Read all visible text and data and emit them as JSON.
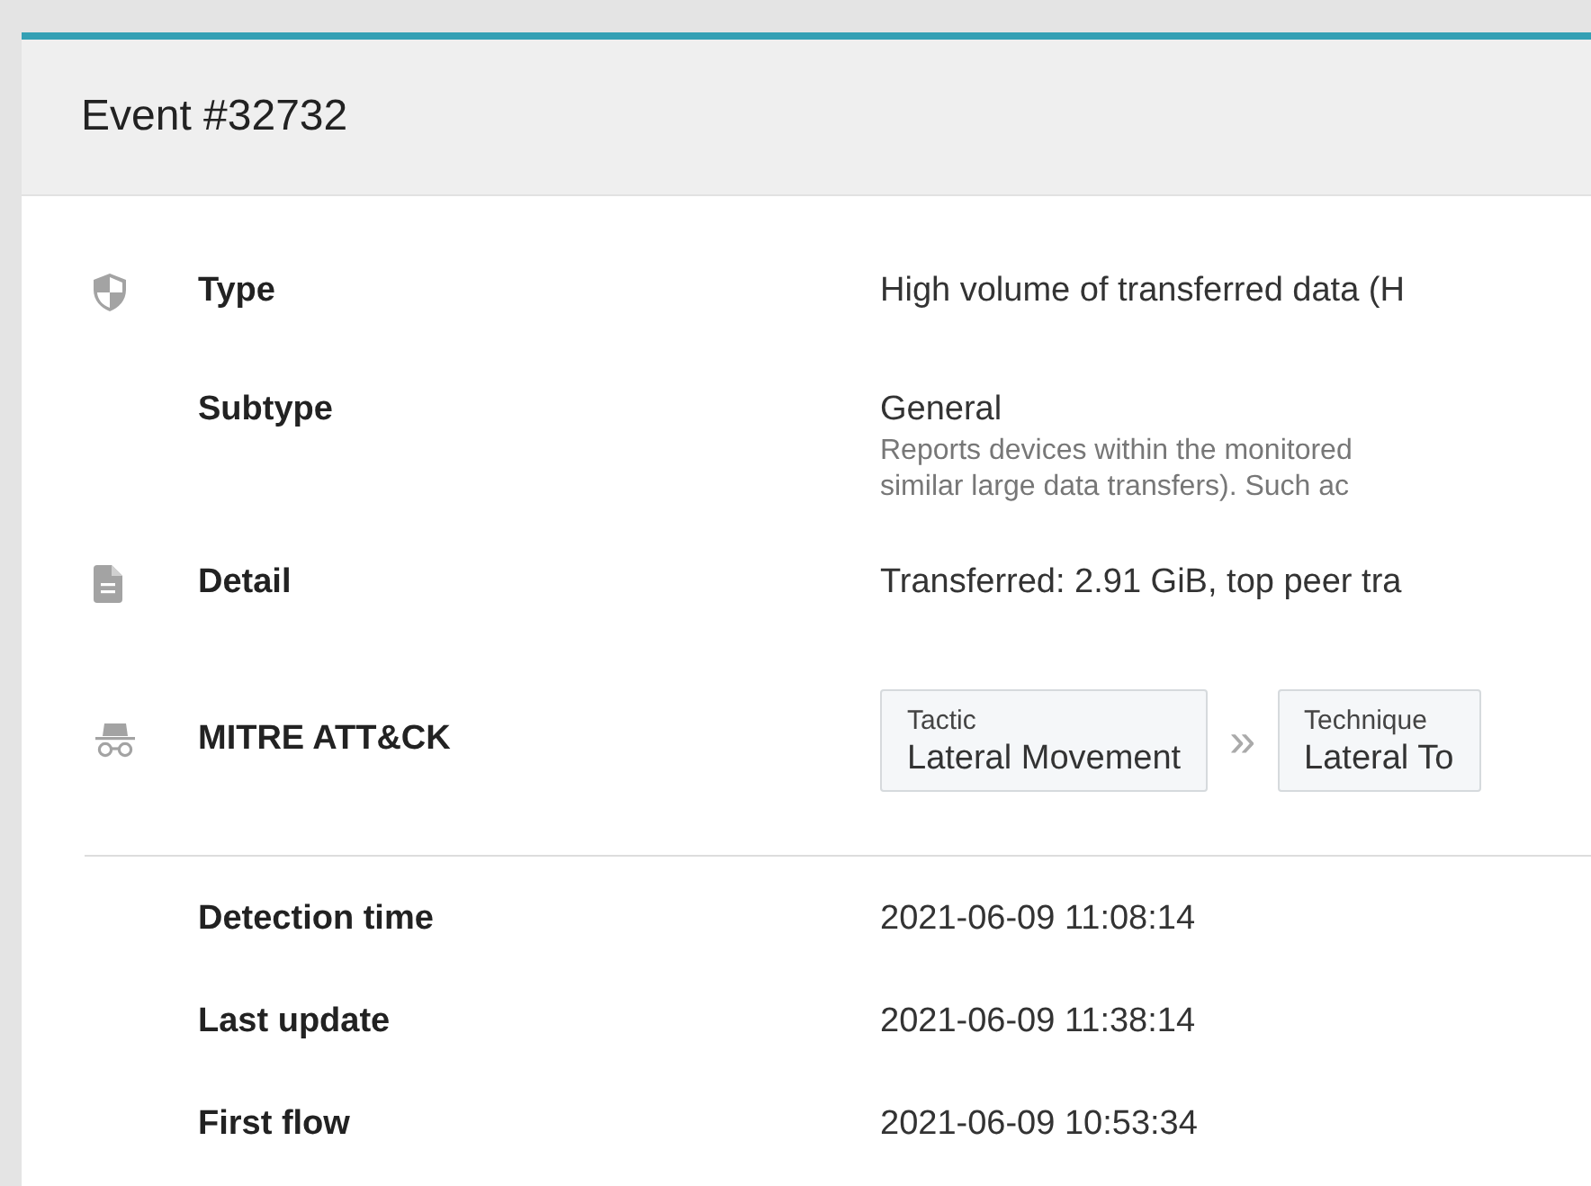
{
  "panel": {
    "title": "Event #32732"
  },
  "fields": [
    {
      "kind": "text",
      "label": "Type",
      "value": "High volume of transferred data (H"
    },
    {
      "kind": "described",
      "label": "Subtype",
      "value": "General",
      "description": [
        "Reports devices within the monitored",
        "similar large data transfers). Such ac"
      ]
    },
    {
      "kind": "text",
      "label": "Detail",
      "value": "Transferred: 2.91 GiB, top peer tra"
    },
    {
      "kind": "tags",
      "label": "MITRE ATT&CK",
      "tags": [
        {
          "caption": "Tactic",
          "value": "Lateral Movement"
        },
        {
          "caption": "Technique",
          "value": "Lateral To"
        }
      ],
      "separator": "»"
    }
  ],
  "times": [
    {
      "label": "Detection time",
      "value": "2021-06-09 11:08:14"
    },
    {
      "label": "Last update",
      "value": "2021-06-09 11:38:14"
    },
    {
      "label": "First flow",
      "value": "2021-06-09 10:53:34"
    }
  ]
}
